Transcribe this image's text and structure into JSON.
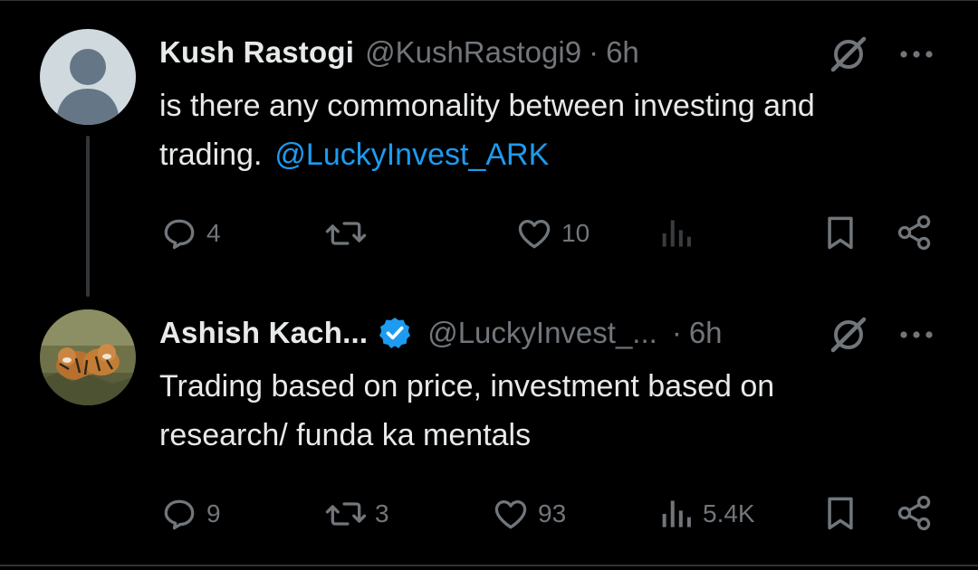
{
  "tweets": [
    {
      "author": {
        "name": "Kush Rastogi",
        "handle": "@KushRastogi9",
        "separator": "·",
        "time": "6h"
      },
      "text": "is there any commonality between  investing and trading.",
      "mention": "@LuckyInvest_ARK",
      "stats": {
        "replies": "4",
        "retweets": "",
        "likes": "10",
        "views": ""
      }
    },
    {
      "author": {
        "name": "Ashish Kach...",
        "handle": "@LuckyInvest_...",
        "separator": "·",
        "time": "6h",
        "verified": true
      },
      "text": "Trading based on price, investment based on research/ funda ka mentals",
      "stats": {
        "replies": "9",
        "retweets": "3",
        "likes": "93",
        "views": "5.4K"
      }
    }
  ],
  "colors": {
    "background": "#000000",
    "text": "#e7e9ea",
    "muted": "#71767b",
    "link": "#1d9bf0",
    "verified": "#1d9bf0"
  },
  "icons": [
    "default-avatar-icon",
    "tiger-avatar",
    "grok-icon",
    "more-icon",
    "reply-icon",
    "retweet-icon",
    "like-icon",
    "views-icon",
    "bookmark-icon",
    "share-icon",
    "verified-badge-icon"
  ]
}
